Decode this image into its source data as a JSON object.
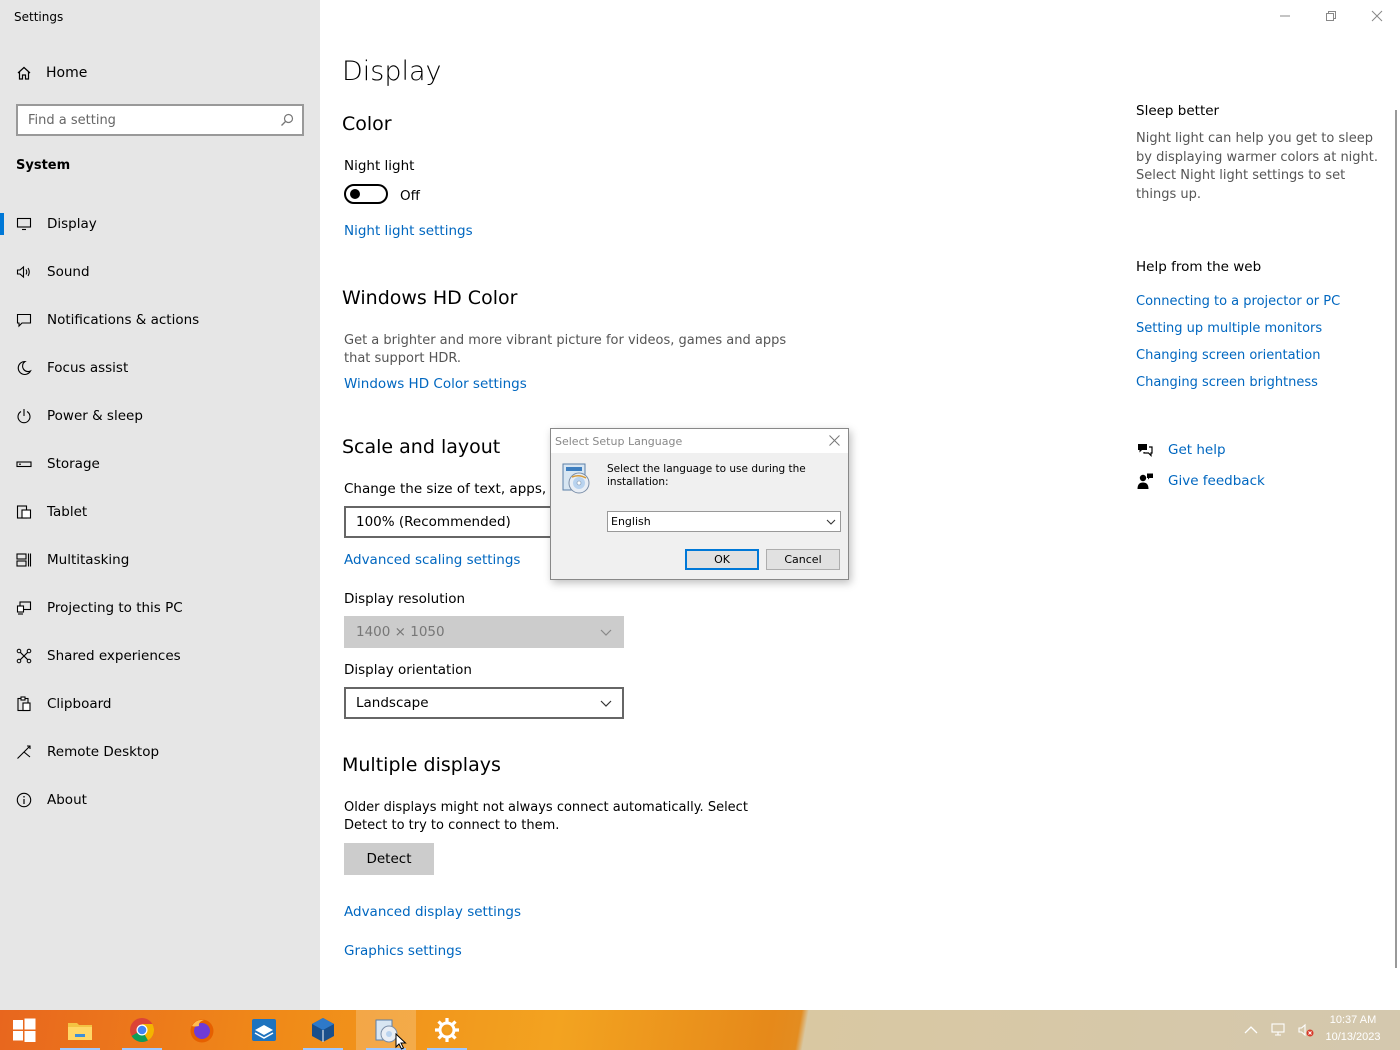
{
  "app": {
    "title": "Settings"
  },
  "sidebar": {
    "home_label": "Home",
    "search_placeholder": "Find a setting",
    "section": "System",
    "items": [
      {
        "label": "Display",
        "icon": "monitor-icon"
      },
      {
        "label": "Sound",
        "icon": "speaker-icon"
      },
      {
        "label": "Notifications & actions",
        "icon": "notification-icon"
      },
      {
        "label": "Focus assist",
        "icon": "moon-icon"
      },
      {
        "label": "Power & sleep",
        "icon": "power-icon"
      },
      {
        "label": "Storage",
        "icon": "storage-icon"
      },
      {
        "label": "Tablet",
        "icon": "tablet-icon"
      },
      {
        "label": "Multitasking",
        "icon": "multitasking-icon"
      },
      {
        "label": "Projecting to this PC",
        "icon": "projector-icon"
      },
      {
        "label": "Shared experiences",
        "icon": "shared-icon"
      },
      {
        "label": "Clipboard",
        "icon": "clipboard-icon"
      },
      {
        "label": "Remote Desktop",
        "icon": "remote-icon"
      },
      {
        "label": "About",
        "icon": "info-icon"
      }
    ],
    "active_index": 0
  },
  "main": {
    "title": "Display",
    "color": {
      "heading": "Color",
      "night_light_label": "Night light",
      "night_light_state": "Off",
      "night_light_link": "Night light settings"
    },
    "hdr": {
      "heading": "Windows HD Color",
      "description": "Get a brighter and more vibrant picture for videos, games and apps that support HDR.",
      "link": "Windows HD Color settings"
    },
    "scale": {
      "heading": "Scale and layout",
      "size_label": "Change the size of text, apps, and",
      "size_value": "100% (Recommended)",
      "advanced_link": "Advanced scaling settings",
      "resolution_label": "Display resolution",
      "resolution_value": "1400 × 1050",
      "orientation_label": "Display orientation",
      "orientation_value": "Landscape"
    },
    "multiple": {
      "heading": "Multiple displays",
      "description": "Older displays might not always connect automatically. Select Detect to try to connect to them.",
      "detect_button": "Detect",
      "advanced_display_link": "Advanced display settings",
      "graphics_link": "Graphics settings"
    }
  },
  "right": {
    "sleep_heading": "Sleep better",
    "sleep_text": "Night light can help you get to sleep by displaying warmer colors at night. Select Night light settings to set things up.",
    "help_heading": "Help from the web",
    "help_links": [
      "Connecting to a projector or PC",
      "Setting up multiple monitors",
      "Changing screen orientation",
      "Changing screen brightness"
    ],
    "get_help": "Get help",
    "give_feedback": "Give feedback"
  },
  "dialog": {
    "title": "Select Setup Language",
    "message": "Select the language to use during the installation:",
    "language_value": "English",
    "ok_label": "OK",
    "cancel_label": "Cancel"
  },
  "taskbar": {
    "items": [
      "start-icon",
      "file-explorer-icon",
      "chrome-icon",
      "firefox-icon",
      "sandbox-icon",
      "virtualbox-icon",
      "setup-icon",
      "settings-gear-icon"
    ],
    "time": "10:37 AM",
    "date": "10/13/2023"
  },
  "colors": {
    "accent": "#0078d7",
    "link": "#0067c0",
    "sidebar_bg": "#e6e6e6"
  }
}
